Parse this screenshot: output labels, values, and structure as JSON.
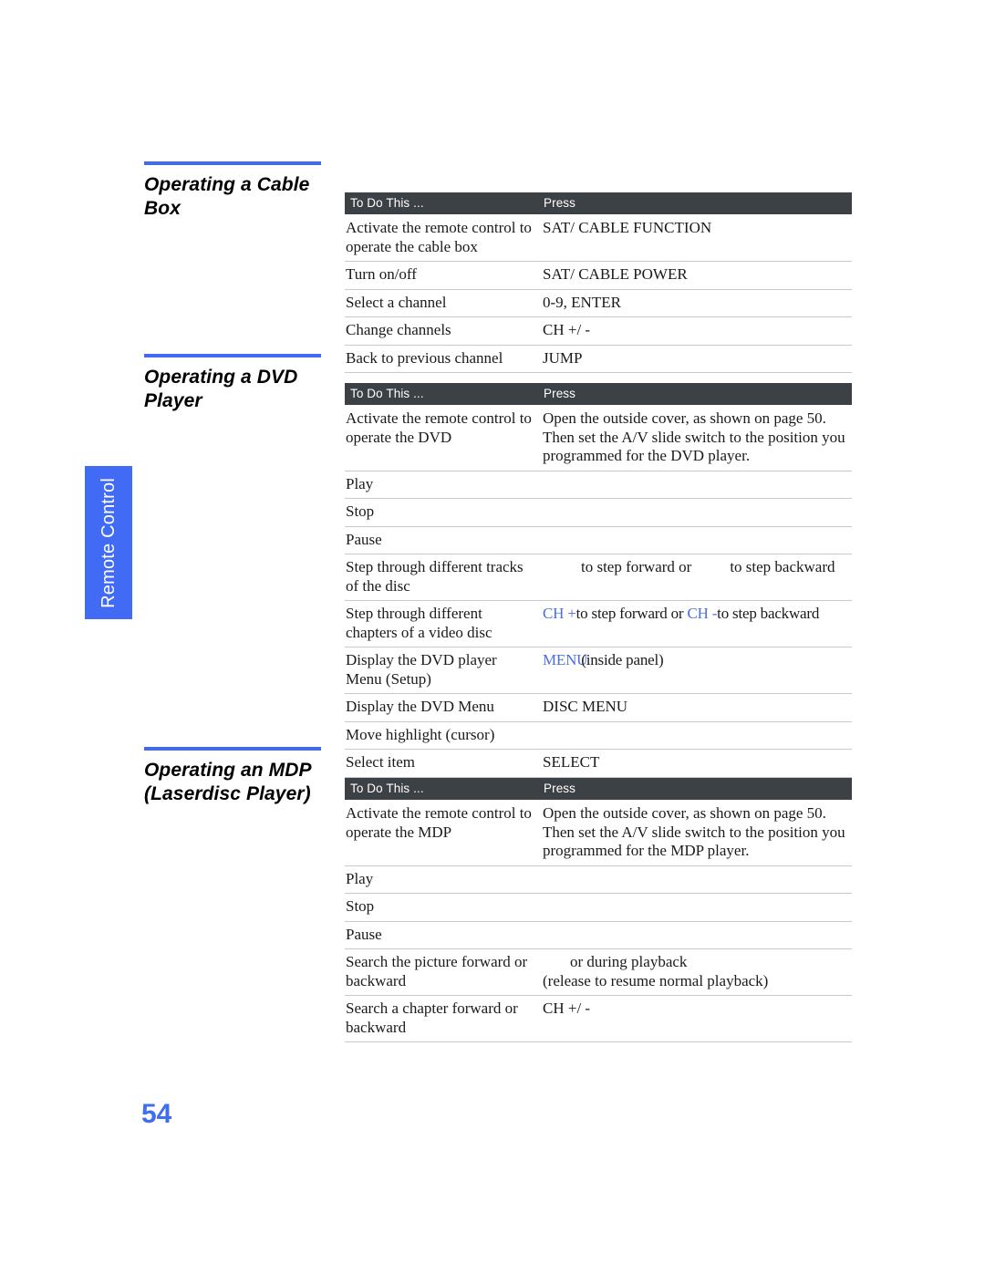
{
  "page": {
    "number": "54",
    "side_tab_label": "Remote Control"
  },
  "sections": [
    {
      "id": "cable",
      "heading": "Operating a Cable Box",
      "table": {
        "columns": [
          "To Do This ...",
          "Press"
        ],
        "rows": [
          {
            "do": "Activate the remote control to operate the cable box",
            "press": "SAT/ CABLE FUNCTION",
            "press_style": "blue"
          },
          {
            "do": "Turn on/off",
            "press": "SAT/ CABLE POWER",
            "press_style": "blue"
          },
          {
            "do": "Select a channel",
            "press": "0-9, ENTER",
            "press_style": "blue"
          },
          {
            "do": "Change channels",
            "press": "CH +/ -",
            "press_style": "blue"
          },
          {
            "do": "Back to previous channel",
            "press": "JUMP",
            "press_style": "blue"
          }
        ]
      }
    },
    {
      "id": "dvd",
      "heading": "Operating a DVD Player",
      "table": {
        "columns": [
          "To Do This ...",
          "Press"
        ],
        "rows": [
          {
            "do": "Activate the remote control to operate the DVD",
            "press": "Open the outside cover, as shown on page 50. Then set the A/V slide switch to the position you programmed for the DVD player.",
            "press_style": "plain"
          },
          {
            "do": "Play",
            "press": "",
            "press_style": "icon"
          },
          {
            "do": "Stop",
            "press": "",
            "press_style": "icon"
          },
          {
            "do": "Pause",
            "press": "",
            "press_style": "icon"
          },
          {
            "do": "Step through different tracks of the disc",
            "press": "to step forward or",
            "press_style": "icon-pair",
            "press_b": "to step backward"
          },
          {
            "do": "Step through different chapters of a video disc",
            "press_parts": [
              {
                "text": "CH +",
                "style": "blue"
              },
              {
                "text": "to step forward or ",
                "style": "plain"
              },
              {
                "text": "CH -",
                "style": "blue"
              },
              {
                "text": "to step backward",
                "style": "plain"
              }
            ]
          },
          {
            "do": "Display the DVD player Menu (Setup)",
            "press_parts": [
              {
                "text": "MENU",
                "style": "blue"
              },
              {
                "text": "(inside panel)",
                "style": "plain"
              }
            ]
          },
          {
            "do": "Display the DVD Menu",
            "press": "DISC MENU",
            "press_style": "blue"
          },
          {
            "do": "Move highlight (cursor)",
            "press": "",
            "press_style": "icon"
          },
          {
            "do": "Select item",
            "press": "SELECT",
            "press_style": "blue"
          }
        ]
      }
    },
    {
      "id": "mdp",
      "heading": "Operating an MDP (Laserdisc Player)",
      "table": {
        "columns": [
          "To Do This ...",
          "Press"
        ],
        "rows": [
          {
            "do": "Activate the remote control to operate the MDP",
            "press": "Open the outside cover, as shown on page 50. Then set the A/V slide switch to the position you programmed for the MDP player.",
            "press_style": "plain"
          },
          {
            "do": "Play",
            "press": "",
            "press_style": "icon"
          },
          {
            "do": "Stop",
            "press": "",
            "press_style": "icon"
          },
          {
            "do": "Pause",
            "press": "",
            "press_style": "icon"
          },
          {
            "do": "Search the picture forward or backward",
            "press": "or        during playback",
            "press_style": "icon-pair",
            "press_b": "(release to resume normal playback)"
          },
          {
            "do": "Search a chapter forward or backward",
            "press": "CH +/ -",
            "press_style": "blue"
          }
        ]
      }
    }
  ],
  "colors": {
    "accent_blue": "#4169f5",
    "link_blue": "#4a6fe0",
    "header_bar": "#3c4145",
    "tab_blue": "#416bf5"
  }
}
